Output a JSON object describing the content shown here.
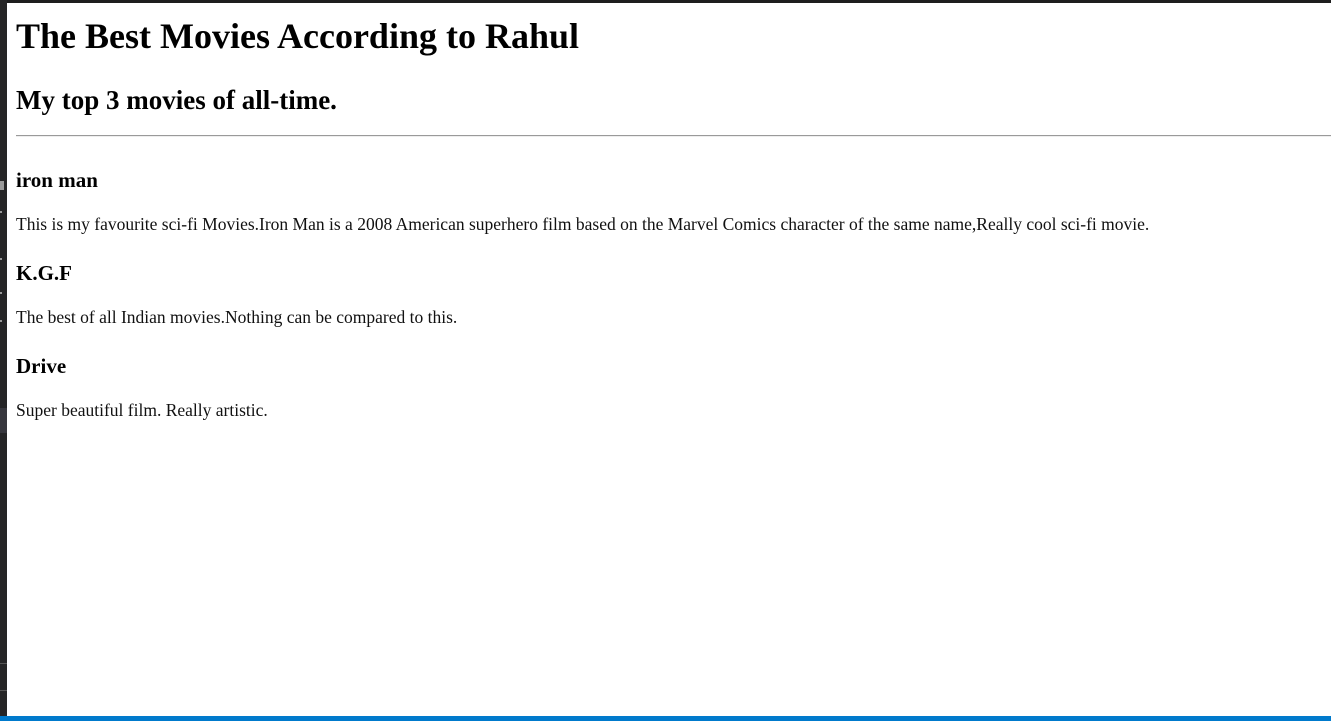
{
  "page": {
    "title": "The Best Movies According to Rahul",
    "subtitle": "My top 3 movies of all-time."
  },
  "movies": [
    {
      "name": "iron man",
      "description": "This is my favourite sci-fi Movies.Iron Man is a 2008 American superhero film based on the Marvel Comics character of the same name,Really cool sci-fi movie."
    },
    {
      "name": "K.G.F",
      "description": "The best of all Indian movies.Nothing can be compared to this."
    },
    {
      "name": "Drive",
      "description": "Super beautiful film. Really artistic."
    }
  ],
  "colors": {
    "page_background": "#ffffff",
    "editor_background": "#1e1e1e",
    "status_bar": "#007acc"
  }
}
